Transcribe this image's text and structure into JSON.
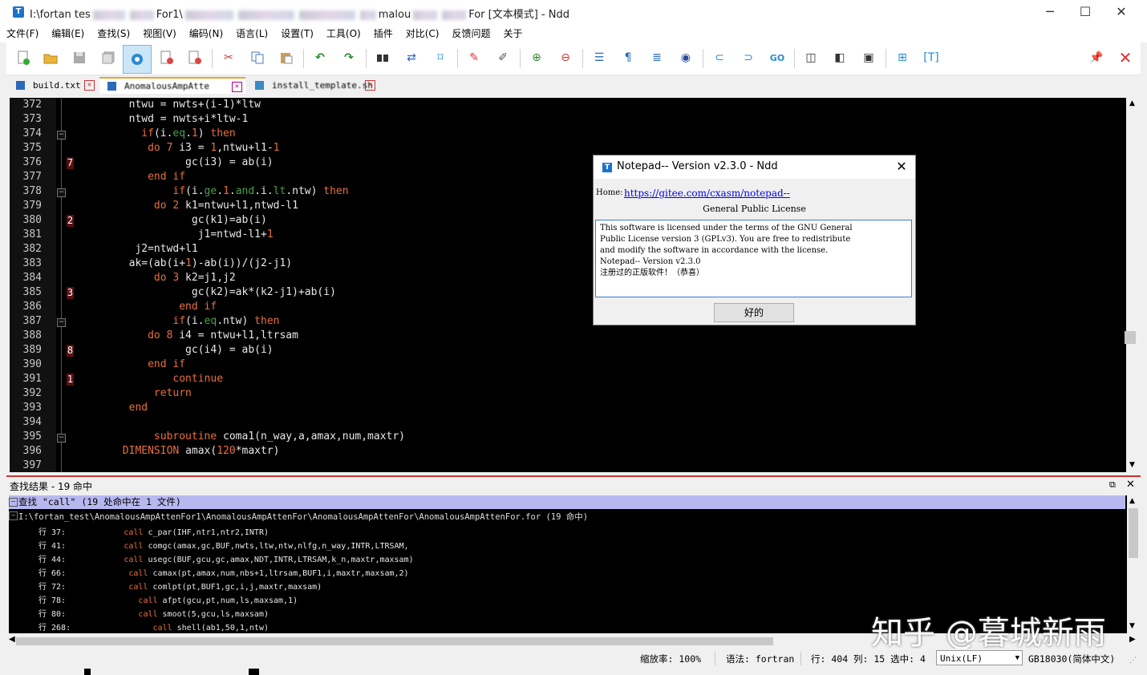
{
  "window": {
    "title_prefix": "I:\\fortan tes",
    "title_mid": "For1\\",
    "title_mid2": "malou",
    "title_suffix": "For [文本模式] - Ndd",
    "app_icon": "T",
    "minimize": "─",
    "maximize": "☐",
    "close": "✕"
  },
  "menu": [
    "文件(F)",
    "编辑(E)",
    "查找(S)",
    "视图(V)",
    "编码(N)",
    "语言(L)",
    "设置(T)",
    "工具(O)",
    "插件",
    "对比(C)",
    "反馈问题",
    "关于"
  ],
  "tabs": [
    {
      "label": "build.txt"
    },
    {
      "label": "AnomalousAmpAtte"
    },
    {
      "label": "install_template.sh"
    }
  ],
  "editor": {
    "lines": [
      {
        "n": "372",
        "mark": "",
        "fold": false,
        "code": [
          [
            "",
            "        ntwu = nwts+(i-1)*ltw"
          ]
        ]
      },
      {
        "n": "373",
        "mark": "",
        "fold": false,
        "code": [
          [
            "",
            "        ntwd = nwts+i*ltw-1"
          ]
        ]
      },
      {
        "n": "374",
        "mark": "",
        "fold": true,
        "code": [
          [
            "",
            "          "
          ],
          [
            "kw",
            "if"
          ],
          [
            "",
            "(i."
          ],
          [
            "kw2",
            "eq"
          ],
          [
            "",
            "."
          ],
          [
            "num",
            "1"
          ],
          [
            "",
            ") "
          ],
          [
            "kw",
            "then"
          ]
        ]
      },
      {
        "n": "375",
        "mark": "",
        "fold": false,
        "code": [
          [
            "",
            "           "
          ],
          [
            "kw",
            "do"
          ],
          [
            "",
            " "
          ],
          [
            "num",
            "7"
          ],
          [
            "",
            " i3 = "
          ],
          [
            "num",
            "1"
          ],
          [
            "",
            ",ntwu+l1-"
          ],
          [
            "num",
            "1"
          ]
        ]
      },
      {
        "n": "376",
        "mark": "7",
        "fold": false,
        "code": [
          [
            "",
            "                 gc(i3) = ab(i)"
          ]
        ]
      },
      {
        "n": "377",
        "mark": "",
        "fold": false,
        "code": [
          [
            "",
            "           "
          ],
          [
            "kw",
            "end if"
          ]
        ]
      },
      {
        "n": "378",
        "mark": "",
        "fold": true,
        "code": [
          [
            "",
            "               "
          ],
          [
            "kw",
            "if"
          ],
          [
            "",
            "(i."
          ],
          [
            "kw2",
            "ge"
          ],
          [
            "",
            "."
          ],
          [
            "num",
            "1"
          ],
          [
            "",
            "."
          ],
          [
            "kw2",
            "and"
          ],
          [
            "",
            ".i."
          ],
          [
            "kw2",
            "lt"
          ],
          [
            "",
            ".ntw) "
          ],
          [
            "kw",
            "then"
          ]
        ]
      },
      {
        "n": "379",
        "mark": "",
        "fold": false,
        "code": [
          [
            "",
            "            "
          ],
          [
            "kw",
            "do"
          ],
          [
            "",
            " "
          ],
          [
            "num",
            "2"
          ],
          [
            "",
            " k1=ntwu+l1,ntwd-l1"
          ]
        ]
      },
      {
        "n": "380",
        "mark": "2",
        "fold": false,
        "code": [
          [
            "",
            "                  gc(k1)=ab(i)"
          ]
        ]
      },
      {
        "n": "381",
        "mark": "",
        "fold": false,
        "code": [
          [
            "",
            "                   j1=ntwd-l1+"
          ],
          [
            "num",
            "1"
          ]
        ]
      },
      {
        "n": "382",
        "mark": "",
        "fold": false,
        "code": [
          [
            "",
            "         j2=ntwd+l1"
          ]
        ]
      },
      {
        "n": "383",
        "mark": "",
        "fold": false,
        "code": [
          [
            "",
            "        ak=(ab(i+"
          ],
          [
            "num",
            "1"
          ],
          [
            "",
            ")-ab(i))/(j2-j1)"
          ]
        ]
      },
      {
        "n": "384",
        "mark": "",
        "fold": false,
        "code": [
          [
            "",
            "            "
          ],
          [
            "kw",
            "do"
          ],
          [
            "",
            " "
          ],
          [
            "num",
            "3"
          ],
          [
            "",
            " k2=j1,j2"
          ]
        ]
      },
      {
        "n": "385",
        "mark": "3",
        "fold": false,
        "code": [
          [
            "",
            "                  gc(k2)=ak*(k2-j1)+ab(i)"
          ]
        ]
      },
      {
        "n": "386",
        "mark": "",
        "fold": false,
        "code": [
          [
            "",
            "                "
          ],
          [
            "kw",
            "end if"
          ]
        ]
      },
      {
        "n": "387",
        "mark": "",
        "fold": true,
        "code": [
          [
            "",
            "               "
          ],
          [
            "kw",
            "if"
          ],
          [
            "",
            "(i."
          ],
          [
            "kw2",
            "eq"
          ],
          [
            "",
            ".ntw) "
          ],
          [
            "kw",
            "then"
          ]
        ]
      },
      {
        "n": "388",
        "mark": "",
        "fold": false,
        "code": [
          [
            "",
            "           "
          ],
          [
            "kw",
            "do"
          ],
          [
            "",
            " "
          ],
          [
            "num",
            "8"
          ],
          [
            "",
            " i4 = ntwu+l1,ltrsam"
          ]
        ]
      },
      {
        "n": "389",
        "mark": "8",
        "fold": false,
        "code": [
          [
            "",
            "                 gc(i4) = ab(i)"
          ]
        ]
      },
      {
        "n": "390",
        "mark": "",
        "fold": false,
        "code": [
          [
            "",
            "           "
          ],
          [
            "kw",
            "end if"
          ]
        ]
      },
      {
        "n": "391",
        "mark": "1",
        "fold": false,
        "code": [
          [
            "",
            "               "
          ],
          [
            "kw",
            "continue"
          ]
        ]
      },
      {
        "n": "392",
        "mark": "",
        "fold": false,
        "code": [
          [
            "",
            "            "
          ],
          [
            "kw",
            "return"
          ]
        ]
      },
      {
        "n": "393",
        "mark": "",
        "fold": false,
        "code": [
          [
            "",
            "        "
          ],
          [
            "kw",
            "end"
          ]
        ]
      },
      {
        "n": "394",
        "mark": "",
        "fold": false,
        "code": [
          [
            "",
            ""
          ]
        ]
      },
      {
        "n": "395",
        "mark": "",
        "fold": true,
        "code": [
          [
            "",
            "            "
          ],
          [
            "kw",
            "subroutine"
          ],
          [
            "",
            " coma1(n_way,a,amax,num,maxtr)"
          ]
        ]
      },
      {
        "n": "396",
        "mark": "",
        "fold": false,
        "code": [
          [
            "",
            "       "
          ],
          [
            "kw",
            "DIMENSION"
          ],
          [
            "",
            " amax("
          ],
          [
            "num",
            "120"
          ],
          [
            "",
            "*maxtr)"
          ]
        ]
      },
      {
        "n": "397",
        "mark": "",
        "fold": false,
        "code": [
          [
            "",
            ""
          ]
        ]
      }
    ]
  },
  "dialog": {
    "title": "Notepad-- Version v2.3.0 - Ndd",
    "home_label": "Home:",
    "home_link": "https://gitee.com/cxasm/notepad--",
    "license_title": "General Public License",
    "text": "This software is licensed under the terms of the GNU General\nPublic License version 3 (GPLv3). You are free to redistribute\nand modify the software in accordance with the license.\nNotepad-- Version v2.3.0\n注册过的正版软件！（恭喜）",
    "ok": "好的",
    "close": "✕"
  },
  "results": {
    "title": "查找结果 - 19 命中",
    "float": "⧉",
    "close": "✕",
    "query": "查找 \"call\" (19 处命中在 1 文件)",
    "file": "I:\\fortan_test\\AnomalousAmpAttenFor1\\AnomalousAmpAttenFor\\AnomalousAmpAttenFor\\AnomalousAmpAttenFor.for (19 命中)",
    "rows": [
      {
        "line": "行 37:",
        "indent": "     ",
        "kw": "call",
        "rest": " c_par(IHF,ntr1,ntr2,INTR)"
      },
      {
        "line": "行 41:",
        "indent": "     ",
        "kw": "call",
        "rest": " comgc(amax,gc,BUF,nwts,ltw,ntw,nlfg,n_way,INTR,LTRSAM,"
      },
      {
        "line": "行 44:",
        "indent": "     ",
        "kw": "call",
        "rest": " usegc(BUF,gcu,gc,amax,NDT,INTR,LTRSAM,k_n,maxtr,maxsam)"
      },
      {
        "line": "行 66:",
        "indent": "      ",
        "kw": "call",
        "rest": " camax(pt,amax,num,nbs+1,ltrsam,BUF1,i,maxtr,maxsam,2)"
      },
      {
        "line": "行 72:",
        "indent": "      ",
        "kw": "call",
        "rest": " comlpt(pt,BUF1,gc,i,j,maxtr,maxsam)"
      },
      {
        "line": "行 78:",
        "indent": "        ",
        "kw": "call",
        "rest": " afpt(gcu,pt,num,ls,maxsam,1)"
      },
      {
        "line": "行 80:",
        "indent": "        ",
        "kw": "call",
        "rest": " smoot(5,gcu,ls,maxsam)"
      },
      {
        "line": "行 268:",
        "indent": "          ",
        "kw": "call",
        "rest": " shell(ab1,50,1,ntw)"
      }
    ]
  },
  "watermark": "知乎 @暮城新雨",
  "status": {
    "zoom": "缩放率: 100%",
    "syntax": "语法: fortran",
    "position": "行: 404 列: 15 选中: 4",
    "eol": "Unix(LF)",
    "encoding": "GB18030(简体中文)"
  },
  "colors": {
    "keyword": "#e86f3d",
    "operator_kw": "#4aa04a",
    "mark_bg": "#5a1010",
    "result_query_bg": "#b8b8f0"
  }
}
